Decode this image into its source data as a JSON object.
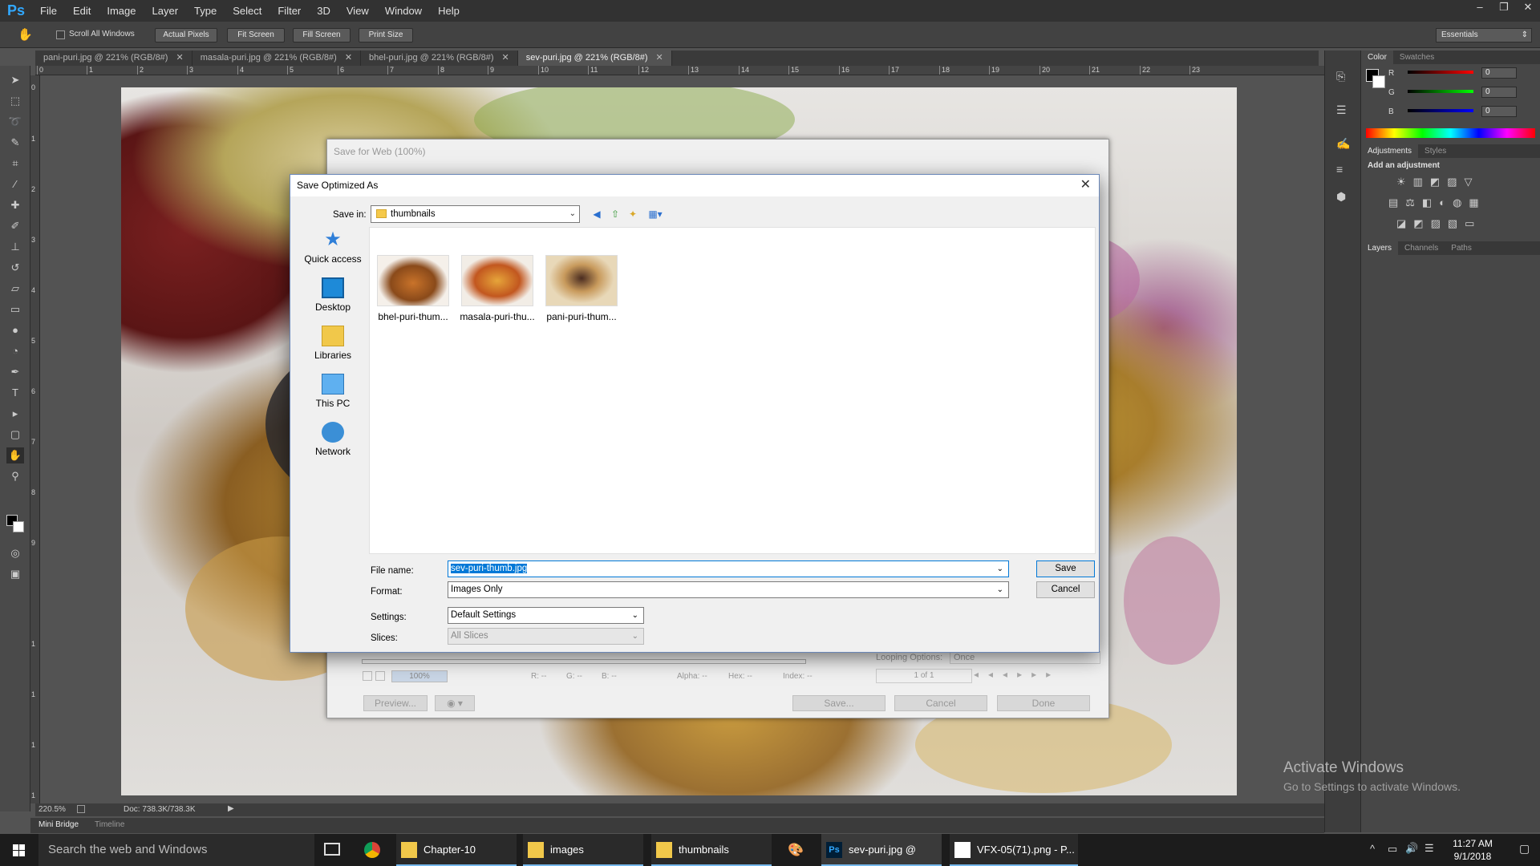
{
  "app": {
    "logo": "Ps"
  },
  "menu": [
    "File",
    "Edit",
    "Image",
    "Layer",
    "Type",
    "Select",
    "Filter",
    "3D",
    "View",
    "Window",
    "Help"
  ],
  "window_controls": [
    "–",
    "❐",
    "✕"
  ],
  "options_bar": {
    "scroll_all": "Scroll All Windows",
    "actual_pixels": "Actual Pixels",
    "fit_screen": "Fit Screen",
    "fill_screen": "Fill Screen",
    "print_size": "Print Size",
    "workspace": "Essentials"
  },
  "doc_tabs": [
    {
      "label": "pani-puri.jpg @ 221% (RGB/8#)",
      "active": false
    },
    {
      "label": "masala-puri.jpg @ 221% (RGB/8#)",
      "active": false
    },
    {
      "label": "bhel-puri.jpg @ 221% (RGB/8#)",
      "active": false
    },
    {
      "label": "sev-puri.jpg @ 221% (RGB/8#)",
      "active": true
    }
  ],
  "ruler_top": [
    "0",
    "1",
    "2",
    "3",
    "4",
    "5",
    "6",
    "7",
    "8",
    "9",
    "10",
    "11",
    "12",
    "13",
    "14",
    "15",
    "16",
    "17",
    "18",
    "19",
    "20",
    "21",
    "22",
    "23"
  ],
  "ruler_left": [
    "0",
    "1",
    "2",
    "3",
    "4",
    "5",
    "6",
    "7",
    "8",
    "9",
    "1",
    "1",
    "1",
    "1"
  ],
  "status": {
    "zoom": "220.5%",
    "doc": "Doc: 738.3K/738.3K"
  },
  "bottom_tabs": [
    "Mini Bridge",
    "Timeline"
  ],
  "color_panel": {
    "tabs": [
      "Color",
      "Swatches"
    ],
    "r_label": "R",
    "g_label": "G",
    "b_label": "B",
    "r": "0",
    "g": "0",
    "b": "0"
  },
  "adjustments_panel": {
    "tabs": [
      "Adjustments",
      "Styles"
    ],
    "hint": "Add an adjustment"
  },
  "layers_panel": {
    "tabs": [
      "Layers",
      "Channels",
      "Paths"
    ]
  },
  "sfw": {
    "title": "Save for Web (100%)",
    "zoom": "100%",
    "readout": {
      "r": "R: --",
      "g": "G: --",
      "b": "B: --",
      "alpha": "Alpha: --",
      "hex": "Hex: --",
      "index": "Index: --"
    },
    "looping_label": "Looping Options:",
    "looping_value": "Once",
    "frame": "1 of 1",
    "preview": "Preview...",
    "save": "Save...",
    "cancel": "Cancel",
    "done": "Done"
  },
  "save_dialog": {
    "title": "Save Optimized As",
    "save_in_label": "Save in:",
    "save_in_value": "thumbnails",
    "places": [
      "Quick access",
      "Desktop",
      "Libraries",
      "This PC",
      "Network"
    ],
    "files": [
      "bhel-puri-thum...",
      "masala-puri-thu...",
      "pani-puri-thum..."
    ],
    "file_name_label": "File name:",
    "file_name_value": "sev-puri-thumb.jpg",
    "format_label": "Format:",
    "format_value": "Images Only",
    "settings_label": "Settings:",
    "settings_value": "Default Settings",
    "slices_label": "Slices:",
    "slices_value": "All Slices",
    "save_btn": "Save",
    "cancel_btn": "Cancel"
  },
  "watermark": {
    "line1": "Activate Windows",
    "line2": "Go to Settings to activate Windows."
  },
  "taskbar": {
    "search": "Search the web and Windows",
    "items": [
      "Chapter-10",
      "images",
      "thumbnails",
      "sev-puri.jpg @ 221...",
      "VFX-05(71).png - P..."
    ],
    "time": "11:27 AM",
    "date": "9/1/2018"
  },
  "colors": {
    "ps_blue": "#31a8ff",
    "selection": "#0078d7"
  }
}
